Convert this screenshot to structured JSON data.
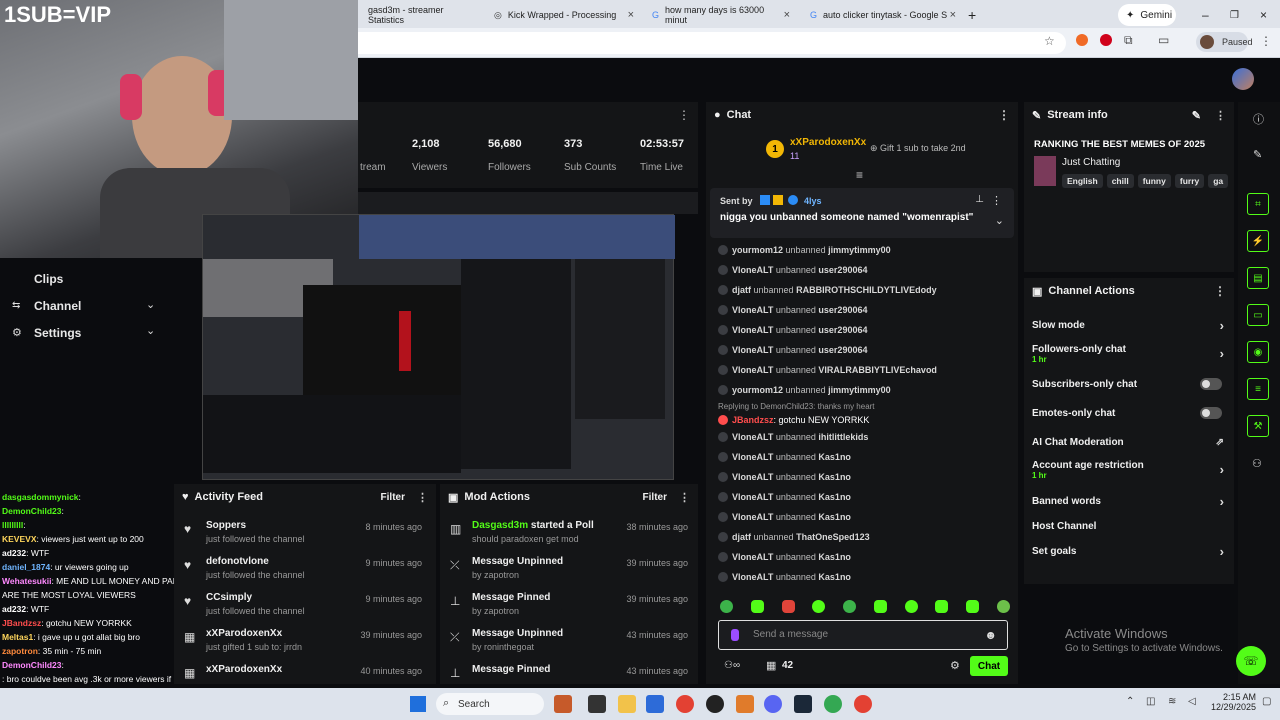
{
  "browser": {
    "tabs": [
      {
        "label": "gasd3m - streamer Statistics"
      },
      {
        "label": "Kick Wrapped - Processing"
      },
      {
        "label": "how many days is 63000 minut"
      },
      {
        "label": "auto clicker tinytask - Google S"
      }
    ],
    "gemini_label": "Gemini",
    "paused_label": "Paused"
  },
  "overlay_text": "1SUB=VIP",
  "stats": [
    {
      "value": "2,108",
      "label": "Viewers"
    },
    {
      "value": "56,680",
      "label": "Followers"
    },
    {
      "value": "373",
      "label": "Sub Counts"
    },
    {
      "value": "02:53:57",
      "label": "Time Live"
    }
  ],
  "stats_partial_label": "tream",
  "sidebar": {
    "items": [
      {
        "label": "Clips"
      },
      {
        "label": "Channel"
      },
      {
        "label": "Settings"
      }
    ]
  },
  "chat": {
    "title": "Chat",
    "top_user": "xXParodoxenXx",
    "top_user_count": "11",
    "gift_text": "Gift 1 sub to take 2nd",
    "pinned_sent_by": "Sent by",
    "pinned_age": "4lys",
    "pinned_message": "nigga you unbanned someone named \"womenrapist\"",
    "messages": [
      {
        "user": "yourmom12",
        "action": "unbanned",
        "target": "jimmytimmy00"
      },
      {
        "user": "VloneALT",
        "action": "unbanned",
        "target": "user290064"
      },
      {
        "user": "djatf",
        "action": "unbanned",
        "target": "RABBIROTHSCHILDYTLIVEdody"
      },
      {
        "user": "VloneALT",
        "action": "unbanned",
        "target": "user290064"
      },
      {
        "user": "VloneALT",
        "action": "unbanned",
        "target": "user290064"
      },
      {
        "user": "VloneALT",
        "action": "unbanned",
        "target": "user290064"
      },
      {
        "user": "VloneALT",
        "action": "unbanned",
        "target": "VIRALRABBIYTLIVEchavod"
      },
      {
        "user": "yourmom12",
        "action": "unbanned",
        "target": "jimmytimmy00"
      }
    ],
    "reply_context": "Replying to DemonChild23: thanks my heart",
    "reply_user": "JBandzsz",
    "reply_text": ": gotchu NEW YORRKK",
    "messages2": [
      {
        "user": "VloneALT",
        "action": "unbanned",
        "target": "ihitlittlekids"
      },
      {
        "user": "VloneALT",
        "action": "unbanned",
        "target": "Kas1no"
      },
      {
        "user": "VloneALT",
        "action": "unbanned",
        "target": "Kas1no"
      },
      {
        "user": "VloneALT",
        "action": "unbanned",
        "target": "Kas1no"
      },
      {
        "user": "VloneALT",
        "action": "unbanned",
        "target": "Kas1no"
      },
      {
        "user": "djatf",
        "action": "unbanned",
        "target": "ThatOneSped123"
      },
      {
        "user": "VloneALT",
        "action": "unbanned",
        "target": "Kas1no"
      },
      {
        "user": "VloneALT",
        "action": "unbanned",
        "target": "Kas1no"
      }
    ],
    "input_placeholder": "Send a message",
    "viewer_count": "42",
    "send_label": "Chat"
  },
  "stream_info": {
    "title": "Stream info",
    "stream_title": "RANKING THE BEST MEMES OF 2025",
    "category": "Just Chatting",
    "tags": [
      "English",
      "chill",
      "funny",
      "furry",
      "ga"
    ]
  },
  "channel_actions": {
    "title": "Channel Actions",
    "items": [
      {
        "label": "Slow mode",
        "sub": "",
        "control": "chevron"
      },
      {
        "label": "Followers-only chat",
        "sub": "1 hr",
        "control": "chevron"
      },
      {
        "label": "Subscribers-only chat",
        "sub": "",
        "control": "toggle"
      },
      {
        "label": "Emotes-only chat",
        "sub": "",
        "control": "toggle"
      },
      {
        "label": "AI Chat Moderation",
        "sub": "",
        "control": "external"
      },
      {
        "label": "Account age restriction",
        "sub": "1 hr",
        "control": "chevron"
      },
      {
        "label": "Banned words",
        "sub": "",
        "control": "chevron"
      },
      {
        "label": "Host Channel",
        "sub": "",
        "control": "none"
      },
      {
        "label": "Set goals",
        "sub": "",
        "control": "chevron"
      }
    ]
  },
  "activity_feed": {
    "title": "Activity Feed",
    "filter_label": "Filter",
    "items": [
      {
        "name": "Soppers",
        "desc": "just followed the channel",
        "time": "8 minutes ago"
      },
      {
        "name": "defonotvlone",
        "desc": "just followed the channel",
        "time": "9 minutes ago"
      },
      {
        "name": "CCsimply",
        "desc": "just followed the channel",
        "time": "9 minutes ago"
      },
      {
        "name": "xXParodoxenXx",
        "desc": "just gifted 1 sub to: jrrdn",
        "time": "39 minutes ago"
      },
      {
        "name": "xXParodoxenXx",
        "desc": "",
        "time": "40 minutes ago"
      }
    ]
  },
  "mod_actions": {
    "title": "Mod Actions",
    "filter_label": "Filter",
    "items": [
      {
        "name": "Dasgasd3m",
        "title_rest": " started a Poll",
        "desc": "should paradoxen get mod",
        "time": "38 minutes ago"
      },
      {
        "name": "",
        "title_rest": "Message Unpinned",
        "desc": "by zapotron",
        "time": "39 minutes ago"
      },
      {
        "name": "",
        "title_rest": "Message Pinned",
        "desc": "by zapotron",
        "time": "39 minutes ago"
      },
      {
        "name": "",
        "title_rest": "Message Unpinned",
        "desc": "by roninthegoat",
        "time": "43 minutes ago"
      },
      {
        "name": "",
        "title_rest": "Message Pinned",
        "desc": "",
        "time": "43 minutes ago"
      }
    ]
  },
  "side_chat": [
    {
      "user": "dasgasdommynick",
      "text": ":"
    },
    {
      "user": "DemonChild23",
      "text": ":"
    },
    {
      "user": "lllllllll",
      "text": ":"
    },
    {
      "user": "KEVEVX",
      "text": ": viewers just went up to 200"
    },
    {
      "user": "ad232",
      "text": ": WTF"
    },
    {
      "user": "daniel_1874",
      "text": ": ur viewers going up"
    },
    {
      "user": "Wehatesukii",
      "text": ": ME AND LUL MONEY AND PARADOX SHOULD GET MOD WE"
    },
    {
      "user": "",
      "text": "ARE THE MOST LOYAL VIEWERS"
    },
    {
      "user": "ad232",
      "text": ": WTF"
    },
    {
      "user": "JBandzsz",
      "text": ": gotchu NEW YORRKK"
    },
    {
      "user": "Meltas1",
      "text": ": i gave up u got allat big bro"
    },
    {
      "user": "zapotron",
      "text": ": 35 min - 75 min"
    },
    {
      "user": "DemonChild23",
      "text": ":"
    },
    {
      "user": "",
      "text": ": bro couldve been avg .3k or more viewers if he never banned"
    }
  ],
  "windows": {
    "activate_title": "Activate Windows",
    "activate_sub": "Go to Settings to activate Windows.",
    "search_label": "Search",
    "time": "2:15 AM",
    "date": "12/29/2025"
  }
}
